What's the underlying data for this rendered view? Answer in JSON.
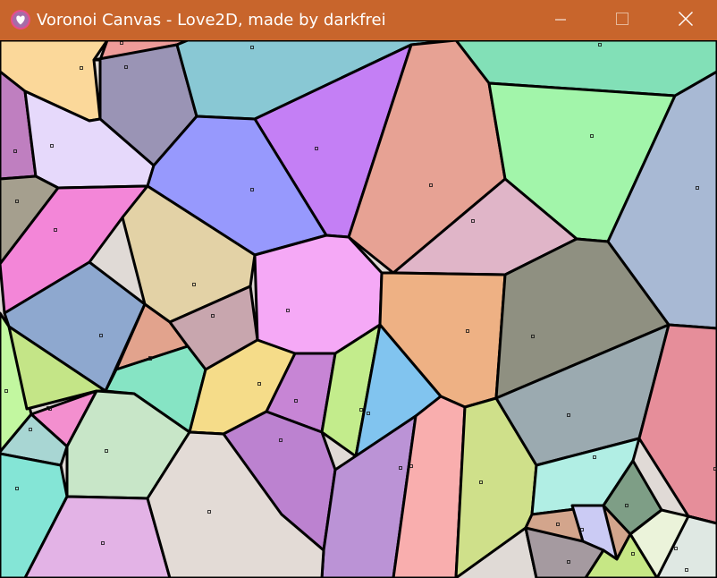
{
  "window": {
    "title": "Voronoi Canvas - Love2D, made by darkfrei",
    "accent_color": "#c8652c",
    "app_icon": "love-heart-icon",
    "controls": {
      "minimize": "minimize-icon",
      "maximize": "maximize-icon",
      "close": "close-icon"
    }
  },
  "canvas": {
    "edge_color": "#000000",
    "cell_colors": [
      "#fbd89a",
      "#ee9c99",
      "#bf7fc0",
      "#9a94b5",
      "#89c8d4",
      "#82e0b7",
      "#e6d9fb",
      "#c47ff5",
      "#e7a294",
      "#a2f5aa",
      "#a59f8e",
      "#9799fd",
      "#e0b5c8",
      "#a8b9d4",
      "#f386d8",
      "#e3d2a6",
      "#f5a9f6",
      "#8ea8cf",
      "#e2a38d",
      "#c8a6ae",
      "#eeb184",
      "#8f9081",
      "#c2f7a0",
      "#c4e587",
      "#86e4c4",
      "#f5dc89",
      "#c785d5",
      "#c3ec8c",
      "#f38fcf",
      "#a8d6d3",
      "#84e5d6",
      "#c8e6c8",
      "#bc82d0",
      "#81c4ef",
      "#bb93d6",
      "#f9aeae",
      "#cfe08a",
      "#9baab0",
      "#e68e9a",
      "#b1eee4",
      "#7e9e86",
      "#d3a58c",
      "#cbcbf4",
      "#ebf3da",
      "#e3b3e6",
      "#e3dbd6",
      "#a59aa0",
      "#c6e785",
      "#dfe8e3"
    ]
  }
}
